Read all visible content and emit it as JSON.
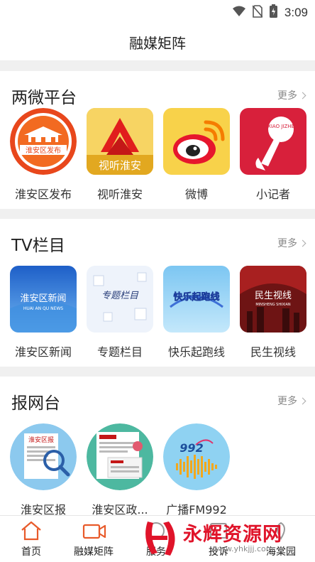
{
  "status_bar": {
    "time": "3:09"
  },
  "header": {
    "title": "融媒矩阵"
  },
  "more_label": "更多",
  "sections": [
    {
      "title": "两微平台",
      "items": [
        {
          "label": "淮安区发布",
          "icon": "huaian-district-release-logo",
          "thumb_text": "淮安区发布"
        },
        {
          "label": "视听淮安",
          "icon": "shiting-huaian-logo",
          "thumb_text": "视听淮安"
        },
        {
          "label": "微博",
          "icon": "weibo-logo"
        },
        {
          "label": "小记者",
          "icon": "little-reporter-logo",
          "thumb_text": "XIAO JIZHE"
        }
      ]
    },
    {
      "title": "TV栏目",
      "items": [
        {
          "label": "淮安区新闻",
          "icon": "huaian-news-logo",
          "thumb_text": "淮安区新闻",
          "thumb_sub": "HUAI AN QU NEWS"
        },
        {
          "label": "专题栏目",
          "icon": "special-topic-logo",
          "thumb_text": "专题栏目"
        },
        {
          "label": "快乐起跑线",
          "icon": "happy-start-line-logo",
          "thumb_text": "快乐起跑线"
        },
        {
          "label": "民生视线",
          "icon": "minsheng-shixian-logo",
          "thumb_text": "民生视线",
          "thumb_sub": "MINSHENG SHIXIAN"
        }
      ]
    },
    {
      "title": "报网台",
      "items": [
        {
          "label": "淮安区报",
          "icon": "district-newspaper-logo",
          "thumb_text": "淮安区报"
        },
        {
          "label": "淮安区政...",
          "icon": "district-government-site-logo"
        },
        {
          "label": "广播FM992",
          "icon": "fm992-radio-logo",
          "thumb_text": "992"
        }
      ]
    }
  ],
  "bottom_nav": [
    {
      "label": "首页",
      "icon": "home-icon"
    },
    {
      "label": "融媒矩阵",
      "icon": "video-camera-icon"
    },
    {
      "label": "服务",
      "icon": "service-icon"
    },
    {
      "label": "投诉",
      "icon": "complaint-icon"
    },
    {
      "label": "海棠园",
      "icon": "garden-icon"
    }
  ],
  "watermark": {
    "text": "永辉资源网",
    "url": "www.yhkjjj.com"
  }
}
